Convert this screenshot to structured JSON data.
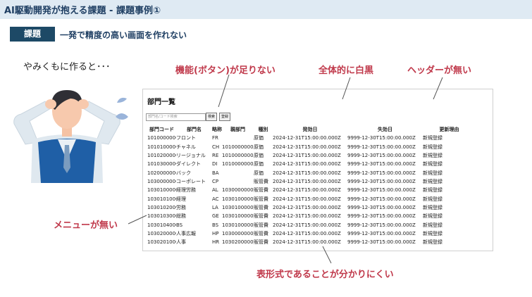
{
  "header": {
    "title": "AI駆動開発が抱える課題 - 課題事例①"
  },
  "issue": {
    "tag": "課題",
    "summary": "一発で精度の高い画面を作れない"
  },
  "intro_text": "やみくもに作ると･･･",
  "callouts": {
    "missing_buttons": "機能(ボタン)が足りない",
    "all_white_black": "全体的に白黒",
    "no_header": "ヘッダーが無い",
    "no_menu": "メニューが無い",
    "table_unclear": "表形式であることが分かりにくい"
  },
  "mock": {
    "page_title": "部門一覧",
    "search_placeholder": "部門名/コード検索",
    "search_button": "検索",
    "register_button": "登録",
    "columns": [
      "部門コード",
      "部門名",
      "略称",
      "親部門",
      "種別",
      "発効日",
      "失効日",
      "更新理由"
    ],
    "rows": [
      [
        "1010000000",
        "フロント",
        "FR",
        "",
        "原価",
        "2024-12-31T15:00:00.000Z",
        "9999-12-30T15:00:00.000Z",
        "新規登録"
      ],
      [
        "1010100000",
        "チャネル",
        "CH",
        "1010000000",
        "原価",
        "2024-12-31T15:00:00.000Z",
        "9999-12-30T15:00:00.000Z",
        "新規登録"
      ],
      [
        "1010200000",
        "リージョナル",
        "RE",
        "1010000000",
        "原価",
        "2024-12-31T15:00:00.000Z",
        "9999-12-30T15:00:00.000Z",
        "新規登録"
      ],
      [
        "1010300000",
        "ダイレクト",
        "DI",
        "1010000000",
        "原価",
        "2024-12-31T15:00:00.000Z",
        "9999-12-30T15:00:00.000Z",
        "新規登録"
      ],
      [
        "1020000000",
        "バック",
        "BA",
        "",
        "原価",
        "2024-12-31T15:00:00.000Z",
        "9999-12-30T15:00:00.000Z",
        "新規登録"
      ],
      [
        "1030000000",
        "コーポレート",
        "CP",
        "",
        "販管費",
        "2024-12-31T15:00:00.000Z",
        "9999-12-30T15:00:00.000Z",
        "新規登録"
      ],
      [
        "1030100000",
        "経理労務",
        "AL",
        "1030000000",
        "販管費",
        "2024-12-31T15:00:00.000Z",
        "9999-12-30T15:00:00.000Z",
        "新規登録"
      ],
      [
        "1030101000",
        "経理",
        "AC",
        "1030100000",
        "販管費",
        "2024-12-31T15:00:00.000Z",
        "9999-12-30T15:00:00.000Z",
        "新規登録"
      ],
      [
        "1030102000",
        "労務",
        "LA",
        "1030100000",
        "販管費",
        "2024-12-31T15:00:00.000Z",
        "9999-12-30T15:00:00.000Z",
        "新規登録"
      ],
      [
        "1030103000",
        "総務",
        "GE",
        "1030100000",
        "販管費",
        "2024-12-31T15:00:00.000Z",
        "9999-12-30T15:00:00.000Z",
        "新規登録"
      ],
      [
        "1030104000",
        "BS",
        "BS",
        "1030100000",
        "販管費",
        "2024-12-31T15:00:00.000Z",
        "9999-12-30T15:00:00.000Z",
        "新規登録"
      ],
      [
        "1030200000",
        "人事広報",
        "HP",
        "1030000000",
        "販管費",
        "2024-12-31T15:00:00.000Z",
        "9999-12-30T15:00:00.000Z",
        "新規登録"
      ],
      [
        "1030201000",
        "人事",
        "HR",
        "1030200000",
        "販管費",
        "2024-12-31T15:00:00.000Z",
        "9999-12-30T15:00:00.000Z",
        "新規登録"
      ]
    ]
  },
  "colors": {
    "accent": "#c0394b",
    "header_bg": "#dfeaf3",
    "tag_bg": "#1d4966",
    "title_text": "#1f3f63"
  },
  "icons": [
    "worried-person-illustration",
    "sweat-drop-icon"
  ]
}
